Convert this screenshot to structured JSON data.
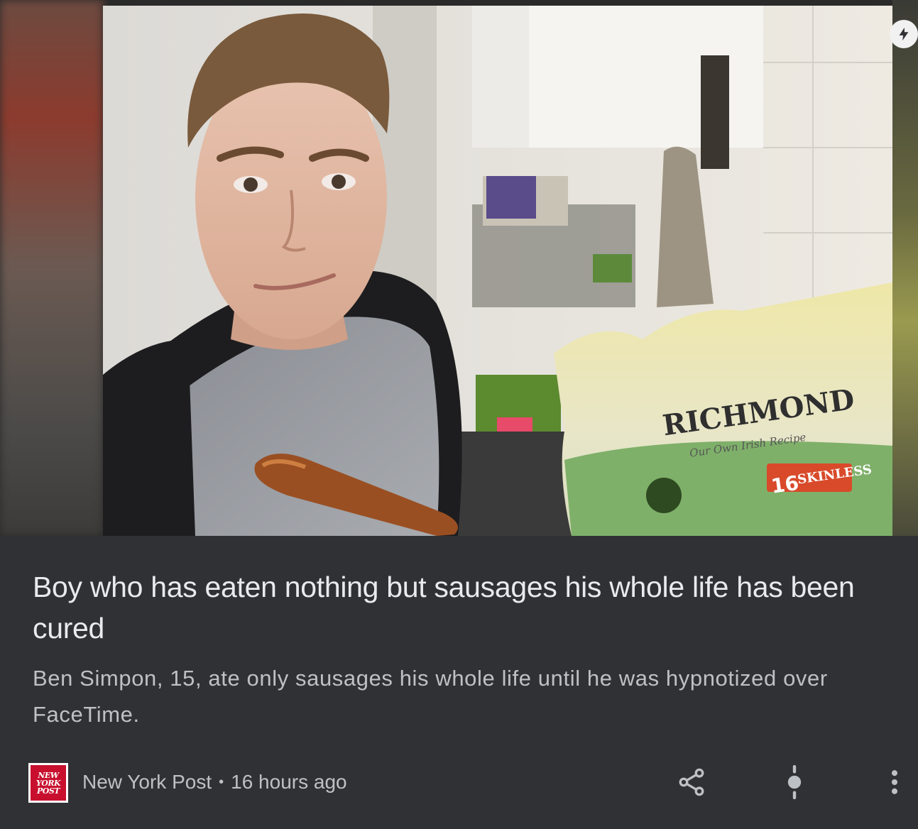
{
  "article": {
    "title": "Boy who has eaten nothing but sausages his whole life has been cured",
    "snippet": "Ben Simpon, 15, ate only sausages his whole life until he was hypnotized over FaceTime.",
    "image_text": {
      "brand": "RICHMOND",
      "tagline": "Our Own Irish Recipe",
      "count": "16",
      "count_label": "SKINLESS"
    }
  },
  "source": {
    "logo_text": [
      "NEW",
      "YORK",
      "POST"
    ],
    "name": "New York Post",
    "separator": "•",
    "time": "16 hours ago"
  },
  "icons": {
    "flash": "flash-icon",
    "share": "share-icon",
    "follow": "follow-icon",
    "more": "more-vert-icon"
  },
  "colors": {
    "card_background": "#303134",
    "title": "#e8eaed",
    "secondary_text": "#bdc1c6",
    "logo_red": "#c8102e"
  }
}
